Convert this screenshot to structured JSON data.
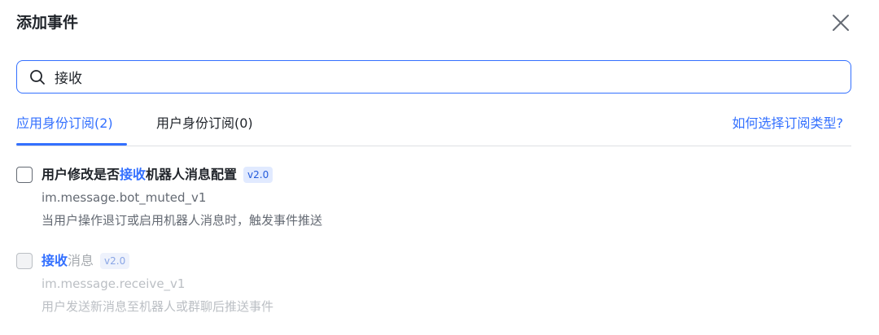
{
  "dialog": {
    "title": "添加事件",
    "close_icon": "close-icon"
  },
  "search": {
    "icon": "search-icon",
    "value": "接收",
    "placeholder": ""
  },
  "tabs": [
    {
      "label": "应用身份订阅(2)",
      "active": true
    },
    {
      "label": "用户身份订阅(0)",
      "active": false
    }
  ],
  "help_link": "如何选择订阅类型?",
  "events": [
    {
      "title_prefix": "用户修改是否",
      "title_match": "接收",
      "title_suffix": "机器人消息配置",
      "version": "v2.0",
      "key": "im.message.bot_muted_v1",
      "description": "当用户操作退订或启用机器人消息时，触发事件推送",
      "checked": false,
      "disabled": false
    },
    {
      "title_prefix": "",
      "title_match": "接收",
      "title_suffix": "消息",
      "version": "v2.0",
      "key": "im.message.receive_v1",
      "description": "用户发送新消息至机器人或群聊后推送事件",
      "checked": false,
      "disabled": true
    }
  ],
  "colors": {
    "accent": "#3370ff",
    "text": "#1f2329",
    "secondary": "#646a73",
    "disabled": "#bbbfc4"
  }
}
